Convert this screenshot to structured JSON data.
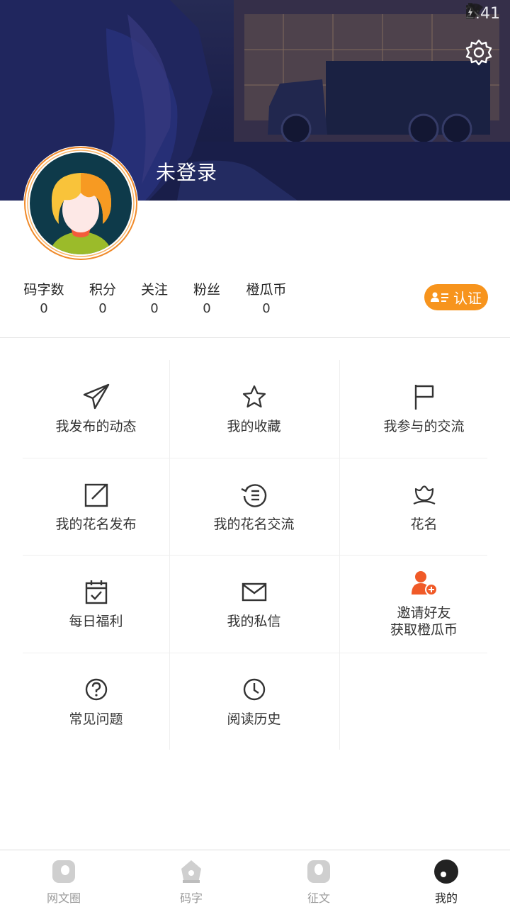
{
  "status_bar": {
    "time": "2:41"
  },
  "profile": {
    "username": "未登录"
  },
  "stats": [
    {
      "label": "码字数",
      "value": "0"
    },
    {
      "label": "积分",
      "value": "0"
    },
    {
      "label": "关注",
      "value": "0"
    },
    {
      "label": "粉丝",
      "value": "0"
    },
    {
      "label": "橙瓜币",
      "value": "0"
    }
  ],
  "verify": {
    "label": "认证"
  },
  "menu": [
    {
      "label": "我发布的动态",
      "icon": "paper-plane-icon"
    },
    {
      "label": "我的收藏",
      "icon": "star-icon"
    },
    {
      "label": "我参与的交流",
      "icon": "flag-icon"
    },
    {
      "label": "我的花名发布",
      "icon": "edit-square-icon"
    },
    {
      "label": "我的花名交流",
      "icon": "history-list-icon"
    },
    {
      "label": "花名",
      "icon": "flower-icon"
    },
    {
      "label": "每日福利",
      "icon": "calendar-check-icon"
    },
    {
      "label": "我的私信",
      "icon": "mail-icon"
    },
    {
      "label": "邀请好友\n获取橙瓜币",
      "icon": "invite-user-icon"
    },
    {
      "label": "常见问题",
      "icon": "question-icon"
    },
    {
      "label": "阅读历史",
      "icon": "clock-icon"
    }
  ],
  "bottom_nav": [
    {
      "label": "网文圈",
      "active": false
    },
    {
      "label": "码字",
      "active": false
    },
    {
      "label": "征文",
      "active": false
    },
    {
      "label": "我的",
      "active": true
    }
  ],
  "colors": {
    "accent": "#f7941d",
    "banner": "#1d2250"
  }
}
